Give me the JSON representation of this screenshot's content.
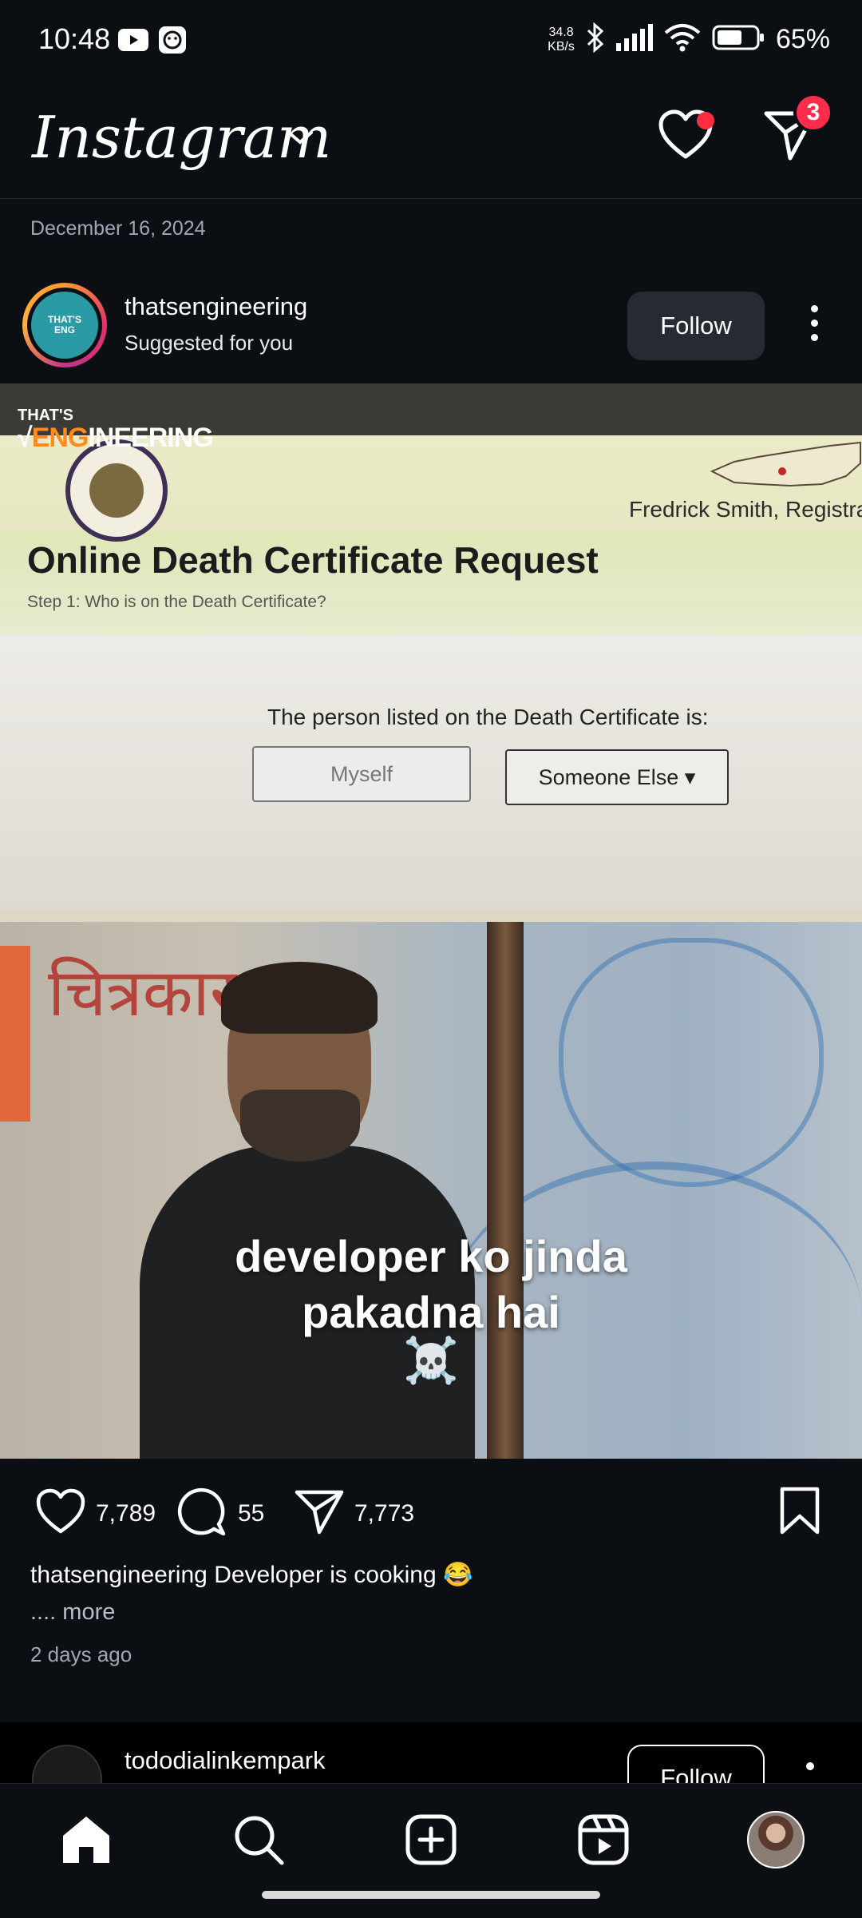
{
  "status_bar": {
    "time": "10:48",
    "net_speed_value": "34.8",
    "net_speed_unit": "KB/s",
    "battery": "65%"
  },
  "header": {
    "app_title": "Instagram",
    "notifications_badge": "3"
  },
  "previous_post": {
    "date": "December 16, 2024"
  },
  "post": {
    "username": "thatsengineering",
    "subtitle": "Suggested for you",
    "follow_label": "Follow",
    "media": {
      "brand_small": "THAT'S",
      "brand_big_prefix": "√",
      "brand_big_eng": "ENG",
      "brand_big_rest": "INEERING",
      "registrar": "Fredrick Smith, Registra",
      "cert_title": "Online Death Certificate Request",
      "cert_step": "Step 1: Who is on the Death Certificate?",
      "cert_question": "The person listed on the Death Certificate is:",
      "option_myself": "Myself",
      "option_someone_else": "Someone Else ▾",
      "wall_text": "चित्रकार",
      "caption_line1": "developer ko jinda",
      "caption_line2": "pakadna hai",
      "caption_emoji": "☠️"
    },
    "likes": "7,789",
    "comments": "55",
    "shares": "7,773",
    "caption_username": "thatsengineering",
    "caption_text": "Developer is cooking 😂",
    "more_label": ".... more",
    "time_ago": "2 days ago"
  },
  "next_post": {
    "username": "tododialinkempark",
    "follow_label": "Follow"
  },
  "colors": {
    "background": "#0b0f14",
    "badge": "#ff2d4a",
    "follow_button": "#262b33",
    "brand_orange": "#ff8a1f"
  },
  "bottom_nav": {
    "icons": [
      "home-icon",
      "search-icon",
      "create-post-icon",
      "reels-icon",
      "profile-avatar"
    ]
  }
}
